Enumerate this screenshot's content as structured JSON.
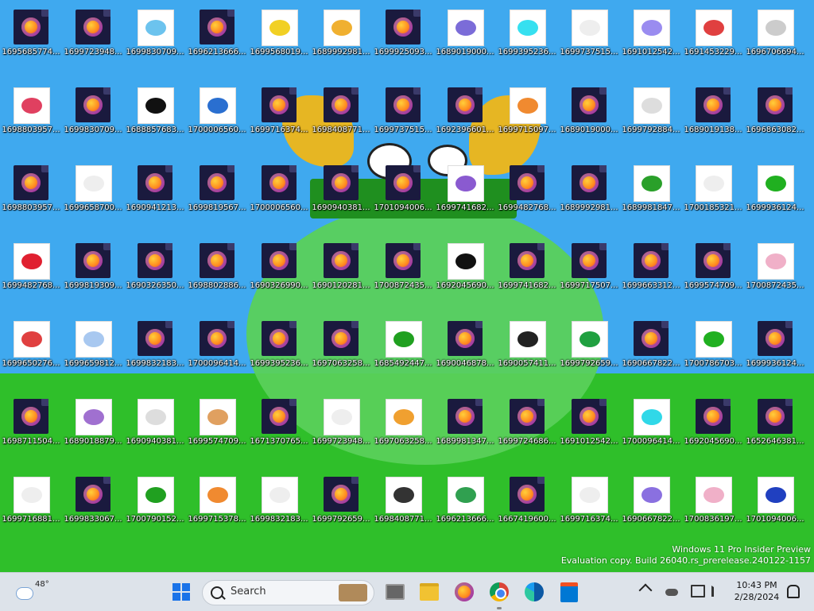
{
  "desktop": {
    "icons": [
      {
        "label": "1695685774...",
        "kind": "ff"
      },
      {
        "label": "1699723948...",
        "kind": "ff"
      },
      {
        "label": "1699830709...",
        "kind": "img",
        "color": "#6cc3ee"
      },
      {
        "label": "1696213666...",
        "kind": "ff"
      },
      {
        "label": "1699568019...",
        "kind": "img",
        "color": "#f1d024"
      },
      {
        "label": "1689992981...",
        "kind": "img",
        "color": "#f0b030"
      },
      {
        "label": "1699925093...",
        "kind": "ff"
      },
      {
        "label": "1689019000...",
        "kind": "img",
        "color": "#7b6cd8"
      },
      {
        "label": "1699395236...",
        "kind": "img",
        "color": "#36e0f0"
      },
      {
        "label": "1699737515...",
        "kind": "img",
        "color": "#eeeeee"
      },
      {
        "label": "1691012542...",
        "kind": "img",
        "color": "#9a8cf0"
      },
      {
        "label": "1691453229...",
        "kind": "img",
        "color": "#e04040"
      },
      {
        "label": "1696706694...",
        "kind": "img",
        "color": "#cccccc"
      },
      {
        "label": "1698803957...",
        "kind": "img",
        "color": "#e04060"
      },
      {
        "label": "1699830709...",
        "kind": "ff"
      },
      {
        "label": "1688857683...",
        "kind": "img",
        "color": "#111111"
      },
      {
        "label": "1700006560...",
        "kind": "img",
        "color": "#2a6fd0"
      },
      {
        "label": "1699716374...",
        "kind": "ff"
      },
      {
        "label": "1698408771...",
        "kind": "ff"
      },
      {
        "label": "1699737515...",
        "kind": "ff"
      },
      {
        "label": "1692396601...",
        "kind": "ff"
      },
      {
        "label": "1699715097...",
        "kind": "img",
        "color": "#f08a30"
      },
      {
        "label": "1689019000...",
        "kind": "ff"
      },
      {
        "label": "1699792884...",
        "kind": "img",
        "color": "#dddddd"
      },
      {
        "label": "1689019138...",
        "kind": "ff"
      },
      {
        "label": "1696863082...",
        "kind": "ff"
      },
      {
        "label": "1698803957...",
        "kind": "ff"
      },
      {
        "label": "1699658700...",
        "kind": "img",
        "color": "#eeeeee"
      },
      {
        "label": "1690941213...",
        "kind": "ff"
      },
      {
        "label": "1699819567...",
        "kind": "ff"
      },
      {
        "label": "1700006560...",
        "kind": "ff"
      },
      {
        "label": "1690940381...",
        "kind": "ff"
      },
      {
        "label": "1701094006...",
        "kind": "ff"
      },
      {
        "label": "1699741682...",
        "kind": "img",
        "color": "#8a5ad0"
      },
      {
        "label": "1699482768...",
        "kind": "ff"
      },
      {
        "label": "1689992981...",
        "kind": "ff"
      },
      {
        "label": "1689981847...",
        "kind": "img",
        "color": "#2aa02a"
      },
      {
        "label": "1700185321...",
        "kind": "img",
        "color": "#eeeeee"
      },
      {
        "label": "1699936124...",
        "kind": "img",
        "color": "#20b020"
      },
      {
        "label": "1699482768...",
        "kind": "img",
        "color": "#e02030"
      },
      {
        "label": "1699819309...",
        "kind": "ff"
      },
      {
        "label": "1690326350...",
        "kind": "ff"
      },
      {
        "label": "1698802886...",
        "kind": "ff"
      },
      {
        "label": "1690326990...",
        "kind": "ff"
      },
      {
        "label": "1690120281...",
        "kind": "ff"
      },
      {
        "label": "1700872435...",
        "kind": "ff"
      },
      {
        "label": "1692045690...",
        "kind": "img",
        "color": "#111111"
      },
      {
        "label": "1699741682...",
        "kind": "ff"
      },
      {
        "label": "1699717507...",
        "kind": "ff"
      },
      {
        "label": "1699663312...",
        "kind": "ff"
      },
      {
        "label": "1699574709...",
        "kind": "ff"
      },
      {
        "label": "1700872435...",
        "kind": "img",
        "color": "#f0b0c8"
      },
      {
        "label": "1699650276...",
        "kind": "img",
        "color": "#e04040"
      },
      {
        "label": "1699659812...",
        "kind": "img",
        "color": "#a8c8f0"
      },
      {
        "label": "1699832183...",
        "kind": "ff"
      },
      {
        "label": "1700096414...",
        "kind": "ff"
      },
      {
        "label": "1699395236...",
        "kind": "ff"
      },
      {
        "label": "1697063258...",
        "kind": "ff"
      },
      {
        "label": "1685492447...",
        "kind": "img",
        "color": "#20a020"
      },
      {
        "label": "1690046878...",
        "kind": "ff"
      },
      {
        "label": "1690057411...",
        "kind": "img",
        "color": "#222222"
      },
      {
        "label": "1699792659...",
        "kind": "img",
        "color": "#20a040"
      },
      {
        "label": "1690667822...",
        "kind": "ff"
      },
      {
        "label": "1700786703...",
        "kind": "img",
        "color": "#20b020"
      },
      {
        "label": "1699936124...",
        "kind": "ff"
      },
      {
        "label": "1698711504...",
        "kind": "ff"
      },
      {
        "label": "1689018879...",
        "kind": "img",
        "color": "#a070d0"
      },
      {
        "label": "1690940381...",
        "kind": "img",
        "color": "#dddddd"
      },
      {
        "label": "1699574709...",
        "kind": "img",
        "color": "#e0a060"
      },
      {
        "label": "1671370765...",
        "kind": "ff"
      },
      {
        "label": "1699723948...",
        "kind": "img",
        "color": "#eeeeee"
      },
      {
        "label": "1697063258...",
        "kind": "img",
        "color": "#f0a030"
      },
      {
        "label": "1689981347...",
        "kind": "ff"
      },
      {
        "label": "1699724686...",
        "kind": "ff"
      },
      {
        "label": "1691012542...",
        "kind": "ff"
      },
      {
        "label": "1700096414...",
        "kind": "img",
        "color": "#30d8e8"
      },
      {
        "label": "1692045690...",
        "kind": "ff"
      },
      {
        "label": "1652646381...",
        "kind": "ff"
      },
      {
        "label": "1699716881...",
        "kind": "img",
        "color": "#eeeeee"
      },
      {
        "label": "1699833067...",
        "kind": "ff"
      },
      {
        "label": "1700790152...",
        "kind": "img",
        "color": "#20a020"
      },
      {
        "label": "1699715378...",
        "kind": "img",
        "color": "#f08a30"
      },
      {
        "label": "1699832183...",
        "kind": "img",
        "color": "#eeeeee"
      },
      {
        "label": "1699792659...",
        "kind": "ff"
      },
      {
        "label": "1698408771...",
        "kind": "img",
        "color": "#333333"
      },
      {
        "label": "1696213666...",
        "kind": "img",
        "color": "#30a050"
      },
      {
        "label": "1667419600...",
        "kind": "ff"
      },
      {
        "label": "1699716374...",
        "kind": "img",
        "color": "#eeeeee"
      },
      {
        "label": "1690667822...",
        "kind": "img",
        "color": "#8a70e0"
      },
      {
        "label": "1700836197...",
        "kind": "img",
        "color": "#f0b0c8"
      },
      {
        "label": "1701094006...",
        "kind": "img",
        "color": "#2040c0"
      }
    ]
  },
  "watermark": {
    "line1": "Windows 11 Pro Insider Preview",
    "line2": "Evaluation copy. Build 26040.rs_prerelease.240122-1157"
  },
  "taskbar": {
    "weather_temp": "48°",
    "search_label": "Search",
    "clock_time": "10:43 PM",
    "clock_date": "2/28/2024"
  }
}
